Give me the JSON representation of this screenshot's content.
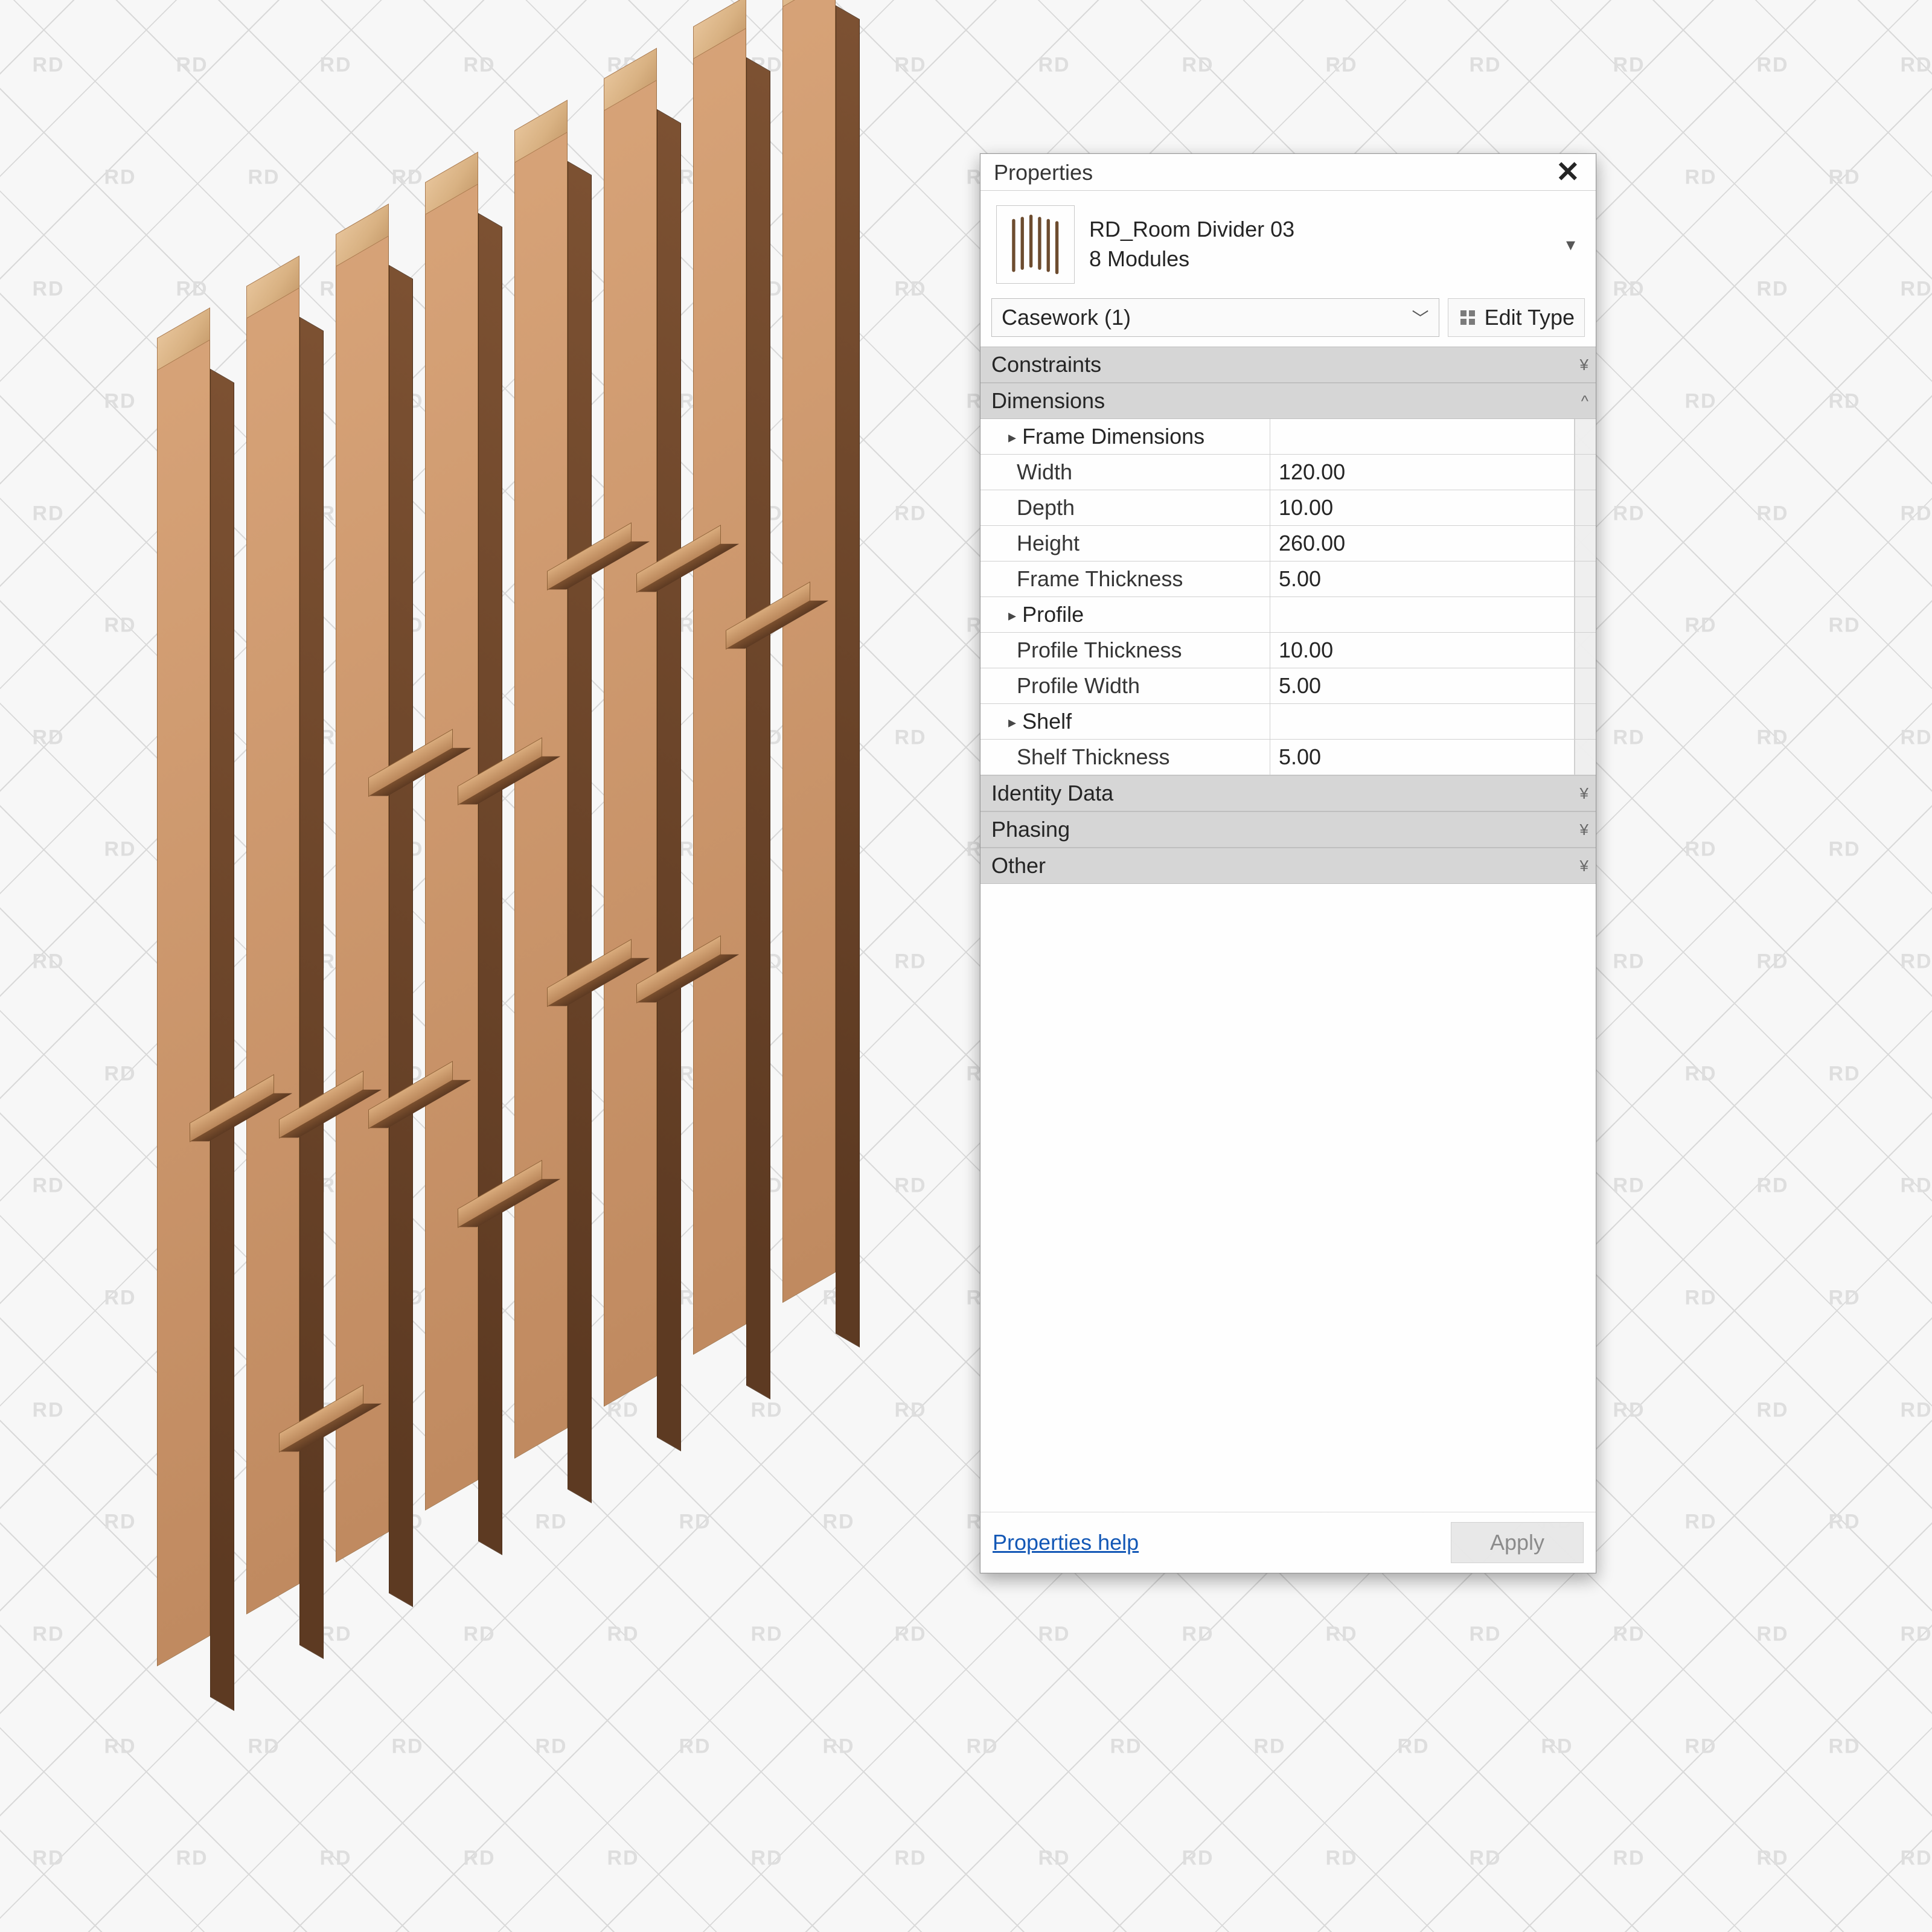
{
  "watermark_text": "RD",
  "panel": {
    "title": "Properties",
    "family_name": "RD_Room Divider 03",
    "type_name": "8 Modules",
    "instance_selector": "Casework (1)",
    "edit_type_label": "Edit Type",
    "groups": {
      "constraints": "Constraints",
      "dimensions": "Dimensions",
      "identity": "Identity Data",
      "phasing": "Phasing",
      "other": "Other"
    },
    "dimensions": {
      "frame_dimensions_label": "Frame Dimensions",
      "width_label": "Width",
      "width_value": "120.00",
      "depth_label": "Depth",
      "depth_value": "10.00",
      "height_label": "Height",
      "height_value": "260.00",
      "frame_thickness_label": "Frame Thickness",
      "frame_thickness_value": "5.00",
      "profile_label": "Profile",
      "profile_thickness_label": "Profile Thickness",
      "profile_thickness_value": "10.00",
      "profile_width_label": "Profile Width",
      "profile_width_value": "5.00",
      "shelf_label": "Shelf",
      "shelf_thickness_label": "Shelf Thickness",
      "shelf_thickness_value": "5.00"
    },
    "help_label": "Properties help",
    "apply_label": "Apply"
  }
}
